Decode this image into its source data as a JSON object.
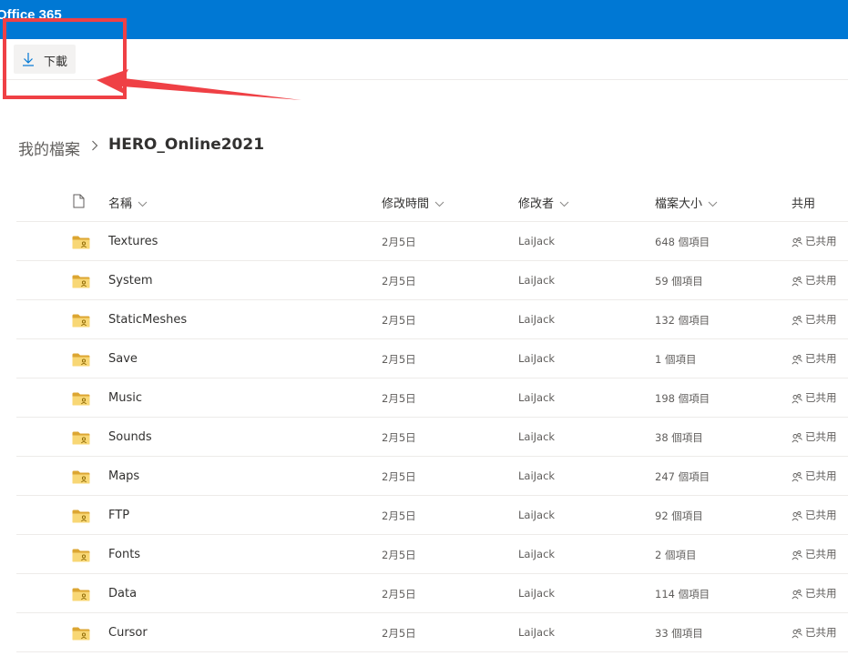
{
  "app": {
    "title": "Office 365"
  },
  "toolbar": {
    "download_label": "下載"
  },
  "breadcrumb": {
    "root": "我的檔案",
    "current": "HERO_Online2021"
  },
  "columns": {
    "name": "名稱",
    "modified": "修改時間",
    "modified_by": "修改者",
    "size": "檔案大小",
    "sharing": "共用"
  },
  "colors": {
    "header_bg": "#0078d4",
    "folder": "#f8d775",
    "annotation": "#ef4045"
  },
  "rows": [
    {
      "name": "Textures",
      "modified": "2月5日",
      "modified_by": "LaiJack",
      "size": "648 個項目",
      "sharing": "已共用"
    },
    {
      "name": "System",
      "modified": "2月5日",
      "modified_by": "LaiJack",
      "size": "59 個項目",
      "sharing": "已共用"
    },
    {
      "name": "StaticMeshes",
      "modified": "2月5日",
      "modified_by": "LaiJack",
      "size": "132 個項目",
      "sharing": "已共用"
    },
    {
      "name": "Save",
      "modified": "2月5日",
      "modified_by": "LaiJack",
      "size": "1 個項目",
      "sharing": "已共用"
    },
    {
      "name": "Music",
      "modified": "2月5日",
      "modified_by": "LaiJack",
      "size": "198 個項目",
      "sharing": "已共用"
    },
    {
      "name": "Sounds",
      "modified": "2月5日",
      "modified_by": "LaiJack",
      "size": "38 個項目",
      "sharing": "已共用"
    },
    {
      "name": "Maps",
      "modified": "2月5日",
      "modified_by": "LaiJack",
      "size": "247 個項目",
      "sharing": "已共用"
    },
    {
      "name": "FTP",
      "modified": "2月5日",
      "modified_by": "LaiJack",
      "size": "92 個項目",
      "sharing": "已共用"
    },
    {
      "name": "Fonts",
      "modified": "2月5日",
      "modified_by": "LaiJack",
      "size": "2 個項目",
      "sharing": "已共用"
    },
    {
      "name": "Data",
      "modified": "2月5日",
      "modified_by": "LaiJack",
      "size": "114 個項目",
      "sharing": "已共用"
    },
    {
      "name": "Cursor",
      "modified": "2月5日",
      "modified_by": "LaiJack",
      "size": "33 個項目",
      "sharing": "已共用"
    }
  ]
}
